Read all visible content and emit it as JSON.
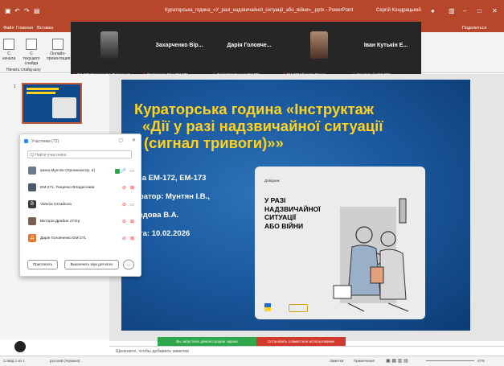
{
  "window": {
    "title": "Кураторська_година_«У_разі_надзвичайної_ситуації_або_війни»_.pptx - PowerPoint",
    "user": "Сергій Кондрацький",
    "share_label": "Поделиться"
  },
  "menu": [
    "Файл",
    "Главная",
    "Вставка"
  ],
  "ribbon": {
    "btn1": "С начала",
    "btn2": "С текущего слайда",
    "btn3": "Онлайн-презентация",
    "group": "Начать слайд-шоу"
  },
  "participants_strip": [
    {
      "name": "",
      "caption": "ЕМ-272 Олександра Фузенцьов"
    },
    {
      "name": "Захарченко Вір...",
      "caption": "Захарченко Віра ЕМ-271"
    },
    {
      "name": "Дарія Головче...",
      "caption": "Дарія Головченко ЕМ-271"
    },
    {
      "name": "",
      "caption": "ЕМ-272 Міхеєва Олена"
    },
    {
      "name": "Іван Кутькін Е...",
      "caption": "Іван Кутькін ЕМ-272"
    }
  ],
  "slide": {
    "title_lines": [
      "Кураторська година «Інструктаж",
      "«Дії у разі надзвичайної ситуації",
      "(сигнал тривоги)»»"
    ],
    "groups": "па ЕМ-172, ЕМ-173",
    "curator": "ратор: Мунтян І.В.,",
    "assistant": "здова В.А.",
    "date": "та: 10.02.2026",
    "card_small": "Довідник",
    "card_main": [
      "У РАЗІ",
      "НАДЗВИЧАЙНОЇ",
      "СИТУАЦІЇ",
      "АБО ВІЙНИ"
    ]
  },
  "thumbnail": {
    "number": "1"
  },
  "panel": {
    "title": "Участники (72)",
    "search_placeholder": "Q Найти участника",
    "participants": [
      {
        "name": "Ірина Мунтян (Организатор, я)",
        "avatar_color": "#6b7a8a",
        "letter": ""
      },
      {
        "name": "ЕМ-271, Тищенко Владислава",
        "avatar_color": "#4a5a6a",
        "letter": ""
      },
      {
        "name": "Valeriia Orzadiova",
        "avatar_color": "#3a3a3a",
        "letter": "В"
      },
      {
        "name": "Вікторія Драбин 272гр",
        "avatar_color": "#7a6050",
        "letter": ""
      },
      {
        "name": "Дарія Головченко ЕМ-271",
        "avatar_color": "#e8742a",
        "letter": "Д"
      }
    ],
    "invite": "Пригласить",
    "mute_all": "Выключить звук для всех",
    "more": "..."
  },
  "share_toolbar": {
    "left": "Вы запустили демонстрацию экрана",
    "right": "Остановить совместное использование"
  },
  "notes": {
    "placeholder": "Щелкните, чтобы добавить заметки"
  },
  "status": {
    "slide": "Слайд 1 из 1",
    "language": "русский (Украина)",
    "notes": "Заметки",
    "comments": "Примечания",
    "zoom": "47%"
  },
  "colors": {
    "ppt_red": "#b7472a",
    "slide_blue": "#1b5aa0",
    "title_yellow": "#ffd21f",
    "share_green": "#2ea84a",
    "share_red": "#d23a2e"
  }
}
